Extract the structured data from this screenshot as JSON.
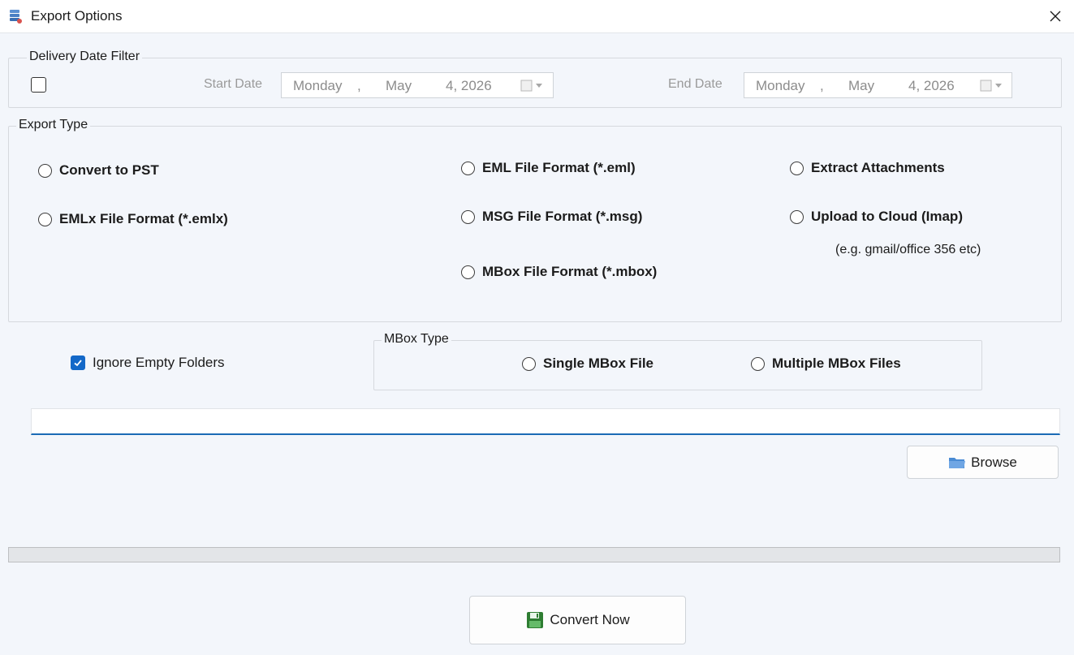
{
  "window": {
    "title": "Export Options"
  },
  "date_filter": {
    "legend": "Delivery Date Filter",
    "enabled": false,
    "start": {
      "label": "Start Date",
      "weekday": "Monday",
      "sep": ",",
      "month": "May",
      "day_year": "4, 2026"
    },
    "end": {
      "label": "End Date",
      "weekday": "Monday",
      "sep": ",",
      "month": "May",
      "day_year": "4, 2026"
    }
  },
  "export_type": {
    "legend": "Export Type",
    "options": {
      "pst": "Convert to PST",
      "emlx": "EMLx File  Format (*.emlx)",
      "eml": "EML File  Format (*.eml)",
      "msg": "MSG File Format (*.msg)",
      "mbox": "MBox File Format (*.mbox)",
      "attachments": "Extract Attachments",
      "cloud": "Upload to Cloud (Imap)"
    },
    "cloud_hint": "(e.g. gmail/office 356 etc)"
  },
  "ignore_empty_folders": {
    "label": "Ignore Empty Folders",
    "checked": true
  },
  "mbox_type": {
    "legend": "MBox Type",
    "single": "Single MBox File",
    "multiple": "Multiple MBox Files"
  },
  "destination": {
    "value": ""
  },
  "buttons": {
    "browse": "Browse",
    "convert": "Convert Now"
  },
  "progress": {
    "value": 0
  },
  "colors": {
    "accent": "#1368c8",
    "input_underline": "#1a6bb5"
  }
}
